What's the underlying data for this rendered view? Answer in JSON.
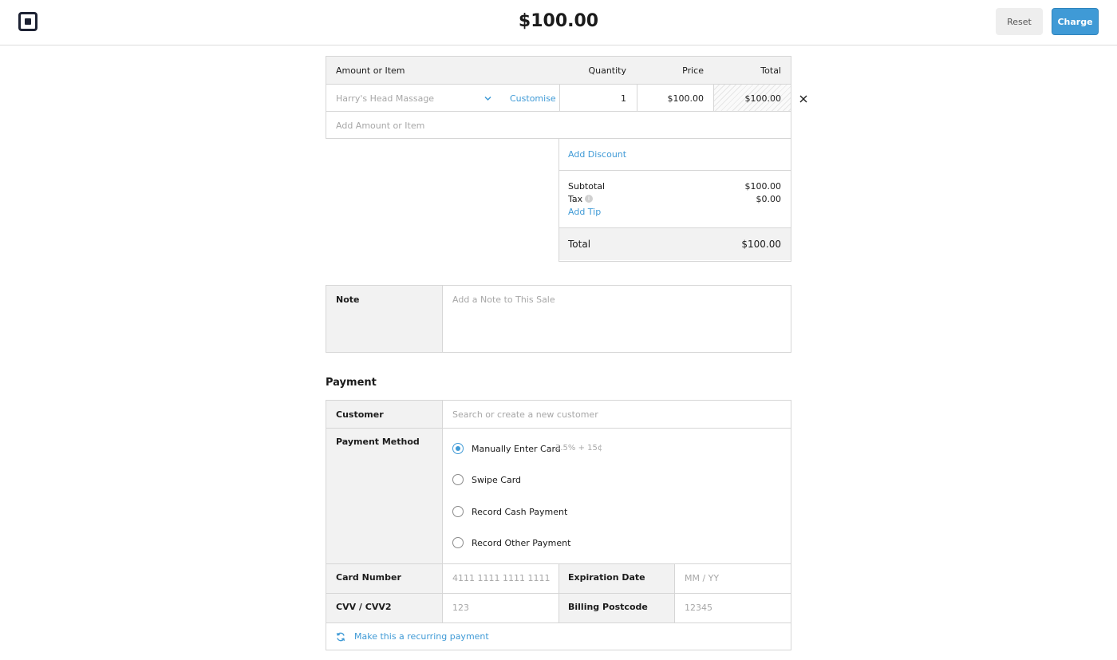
{
  "header": {
    "amount": "$100.00",
    "reset_label": "Reset",
    "charge_label": "Charge"
  },
  "items_table": {
    "columns": [
      "Amount or Item",
      "Quantity",
      "Price",
      "Total"
    ],
    "rows": [
      {
        "item": "Harry's Head Massage",
        "customise": "Customise",
        "quantity": "1",
        "price": "$100.00",
        "total": "$100.00"
      }
    ],
    "add_placeholder": "Add Amount or Item"
  },
  "summary": {
    "add_discount": "Add Discount",
    "subtotal_label": "Subtotal",
    "subtotal_value": "$100.00",
    "tax_label": "Tax",
    "tax_value": "$0.00",
    "add_tip": "Add Tip",
    "total_label": "Total",
    "total_value": "$100.00"
  },
  "note": {
    "label": "Note",
    "placeholder": "Add a Note to This Sale"
  },
  "payment": {
    "title": "Payment",
    "customer_label": "Customer",
    "customer_placeholder": "Search or create a new customer",
    "method_label": "Payment Method",
    "methods": [
      {
        "label": "Manually Enter Card",
        "fee": "3.5% + 15¢",
        "selected": true
      },
      {
        "label": "Swipe Card",
        "selected": false
      },
      {
        "label": "Record Cash Payment",
        "selected": false
      },
      {
        "label": "Record Other Payment",
        "selected": false
      }
    ],
    "card_number_label": "Card Number",
    "card_number_placeholder": "4111 1111 1111 1111",
    "expiration_label": "Expiration Date",
    "expiration_placeholder": "MM / YY",
    "cvv_label": "CVV / CVV2",
    "cvv_placeholder": "123",
    "postcode_label": "Billing Postcode",
    "postcode_placeholder": "12345",
    "recurring_label": "Make this a recurring payment"
  },
  "colors": {
    "accent": "#3f9ad6",
    "label_bg": "#f2f2f2",
    "border": "#d6d6d6"
  }
}
